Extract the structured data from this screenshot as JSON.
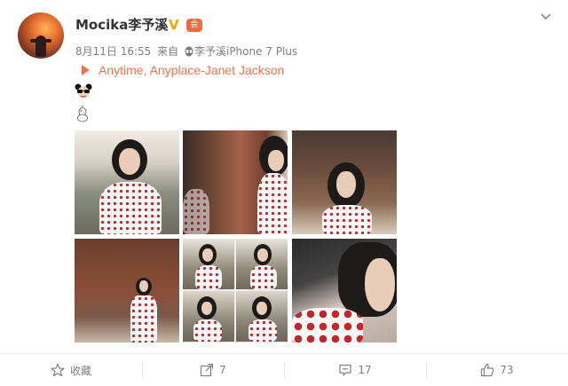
{
  "post": {
    "username": "Mocika李予溪",
    "verified_badge": "V",
    "member_badge": "会",
    "date": "8月11日 16:55",
    "from_label": "来自",
    "device": "李予溪iPhone 7 Plus",
    "song": "Anytime, Anyplace-Janet Jackson",
    "emoji_1": "mickey-sunglasses",
    "emoji_2": "chicken"
  },
  "actions": {
    "favorite": {
      "label": "收藏",
      "icon": "star-icon"
    },
    "repost": {
      "count": "7",
      "icon": "share-icon"
    },
    "comment": {
      "count": "17",
      "icon": "comment-icon"
    },
    "like": {
      "count": "73",
      "icon": "thumbs-up-icon"
    }
  },
  "colors": {
    "song_accent": "#eb7350",
    "verified": "#f7a600",
    "meta_text": "#808080"
  }
}
